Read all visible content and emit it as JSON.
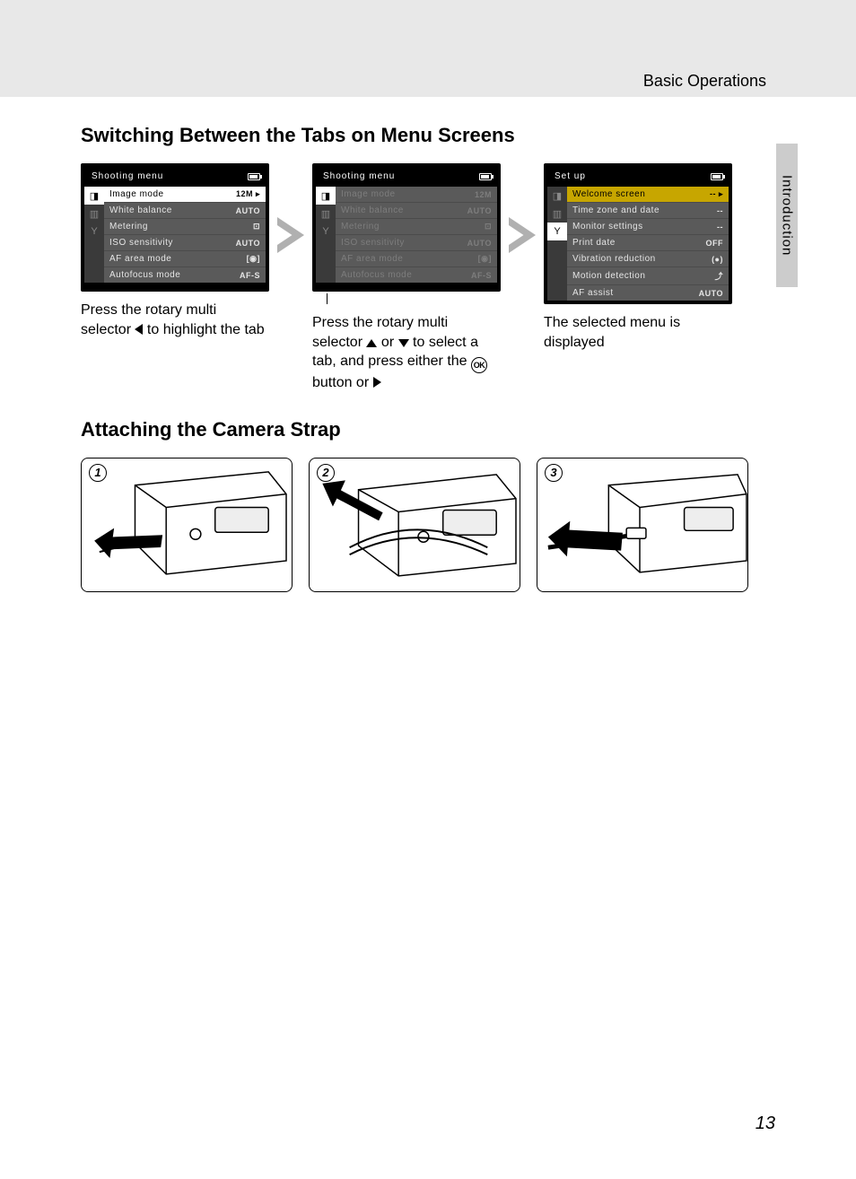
{
  "header": {
    "section_label": "Basic Operations",
    "side_tab": "Introduction"
  },
  "h1": "Switching Between the Tabs on Menu Screens",
  "h2": "Attaching the Camera Strap",
  "page_number": "13",
  "menu1": {
    "title": "Shooting menu",
    "tabs": [
      "camera",
      "video",
      "wrench"
    ],
    "active_tab": 0,
    "highlight": 0,
    "items": [
      {
        "label": "Image mode",
        "val": "12M ▸"
      },
      {
        "label": "White balance",
        "val": "AUTO"
      },
      {
        "label": "Metering",
        "val": "⊡"
      },
      {
        "label": "ISO sensitivity",
        "val": "AUTO"
      },
      {
        "label": "AF area mode",
        "val": "[◉]"
      },
      {
        "label": "Autofocus mode",
        "val": "AF-S"
      }
    ]
  },
  "menu2": {
    "title": "Shooting menu",
    "tabs": [
      "camera",
      "video",
      "wrench"
    ],
    "active_tab": 0,
    "items": [
      {
        "label": "Image mode",
        "val": "12M"
      },
      {
        "label": "White balance",
        "val": "AUTO"
      },
      {
        "label": "Metering",
        "val": "⊡"
      },
      {
        "label": "ISO sensitivity",
        "val": "AUTO"
      },
      {
        "label": "AF area mode",
        "val": "[◉]"
      },
      {
        "label": "Autofocus mode",
        "val": "AF-S"
      }
    ]
  },
  "menu3": {
    "title": "Set up",
    "tabs": [
      "camera",
      "video",
      "wrench"
    ],
    "active_tab": 2,
    "items": [
      {
        "label": "Welcome screen",
        "val": "-- ▸"
      },
      {
        "label": "Time zone and date",
        "val": "--"
      },
      {
        "label": "Monitor settings",
        "val": "--"
      },
      {
        "label": "Print date",
        "val": "OFF"
      },
      {
        "label": "Vibration reduction",
        "val": "(●)"
      },
      {
        "label": "Motion detection",
        "val": "⤴"
      },
      {
        "label": "AF assist",
        "val": "AUTO"
      }
    ]
  },
  "captions": {
    "c1a": "Press the rotary multi selector ",
    "c1b": " to highlight the tab",
    "c2a": "Press the rotary multi selector ",
    "c2b": " or ",
    "c2c": " to select a tab, and press either the ",
    "c2d": " button or ",
    "c3": "The selected menu is displayed",
    "ok": "OK"
  },
  "strap_panels": [
    "1",
    "2",
    "3"
  ]
}
